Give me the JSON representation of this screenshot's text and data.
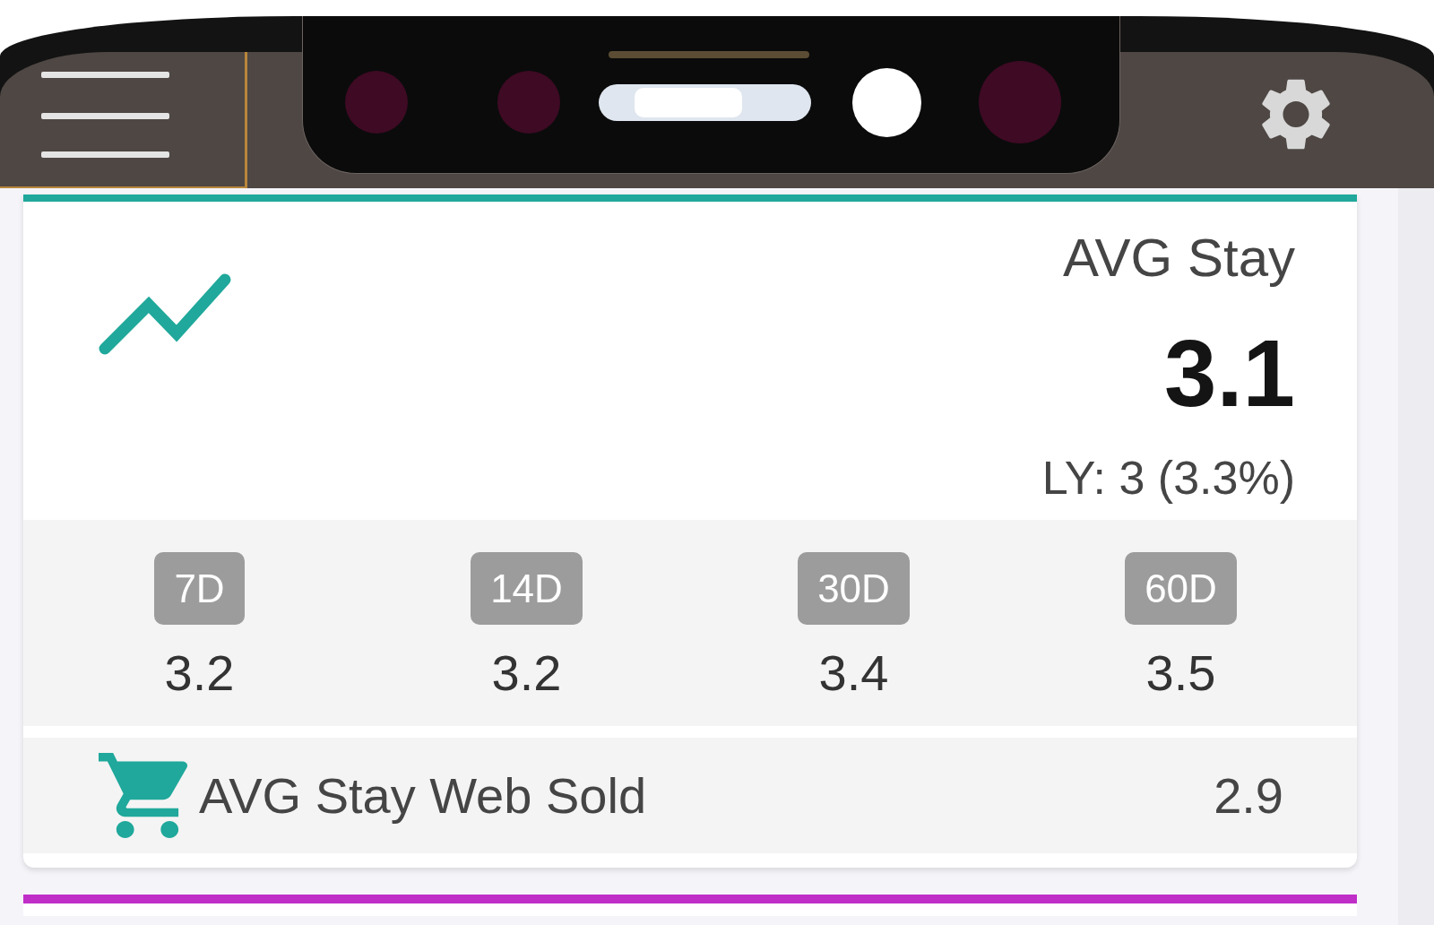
{
  "cards": [
    {
      "color": "#1fa89b",
      "title": "AVG Stay",
      "value": "3.1",
      "last_year": "LY: 3 (3.3%)",
      "periods": [
        {
          "label": "7D",
          "value": "3.2"
        },
        {
          "label": "14D",
          "value": "3.2"
        },
        {
          "label": "30D",
          "value": "3.4"
        },
        {
          "label": "60D",
          "value": "3.5"
        }
      ],
      "web_sold": {
        "label": "AVG Stay Web Sold",
        "value": "2.9"
      }
    },
    {
      "color": "#c02ec8"
    }
  ]
}
